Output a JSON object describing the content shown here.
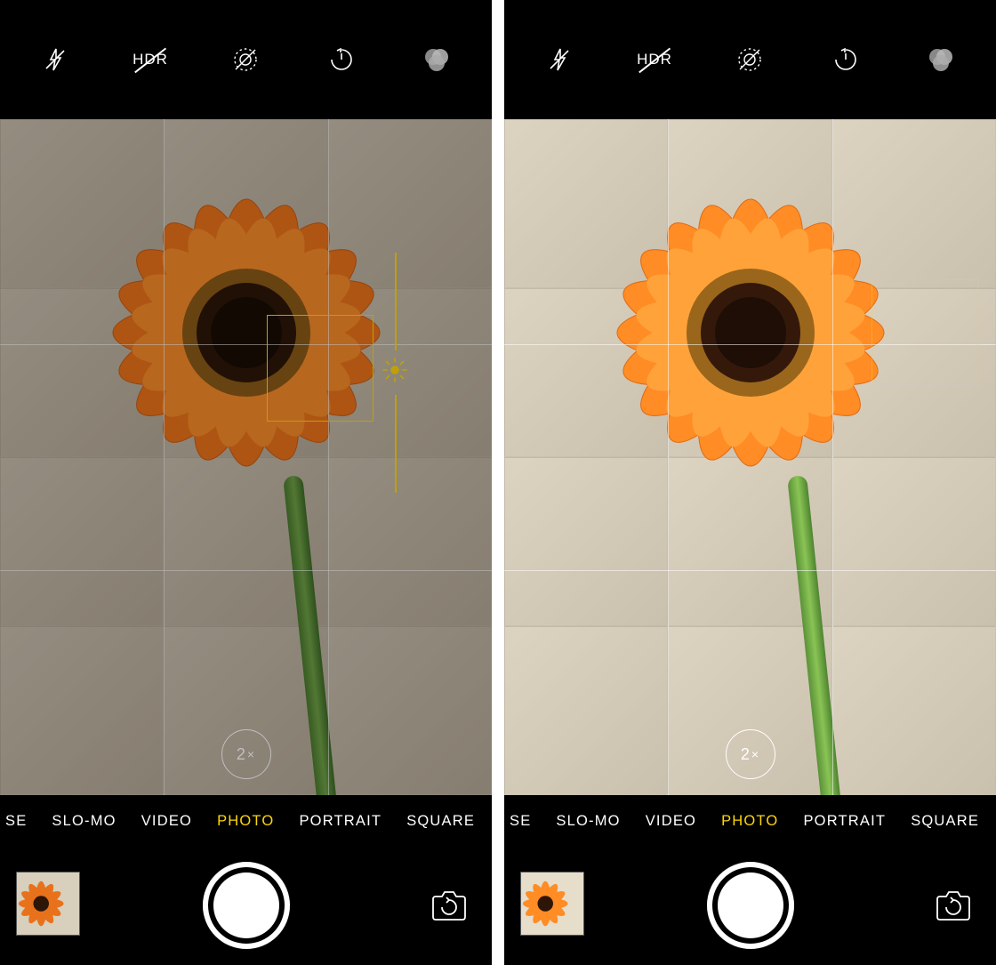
{
  "top": {
    "flash": "flash-off-icon",
    "hdr_label": "HDR",
    "live": "live-photo-off-icon",
    "timer": "timer-icon",
    "filters": "filters-icon"
  },
  "viewfinder": {
    "zoom_label": "2",
    "zoom_suffix": "×",
    "grid": true,
    "focus_visible_left": true,
    "focus_visible_right": false
  },
  "modes": {
    "partial_left": "SE",
    "items": [
      "SLO-MO",
      "VIDEO",
      "PHOTO",
      "PORTRAIT",
      "SQUARE"
    ],
    "active_index": 2
  },
  "controls": {
    "thumbnail": "last-photo-thumbnail",
    "shutter": "shutter-button",
    "flip": "flip-camera-icon"
  },
  "colors": {
    "accent": "#ffd60a"
  }
}
